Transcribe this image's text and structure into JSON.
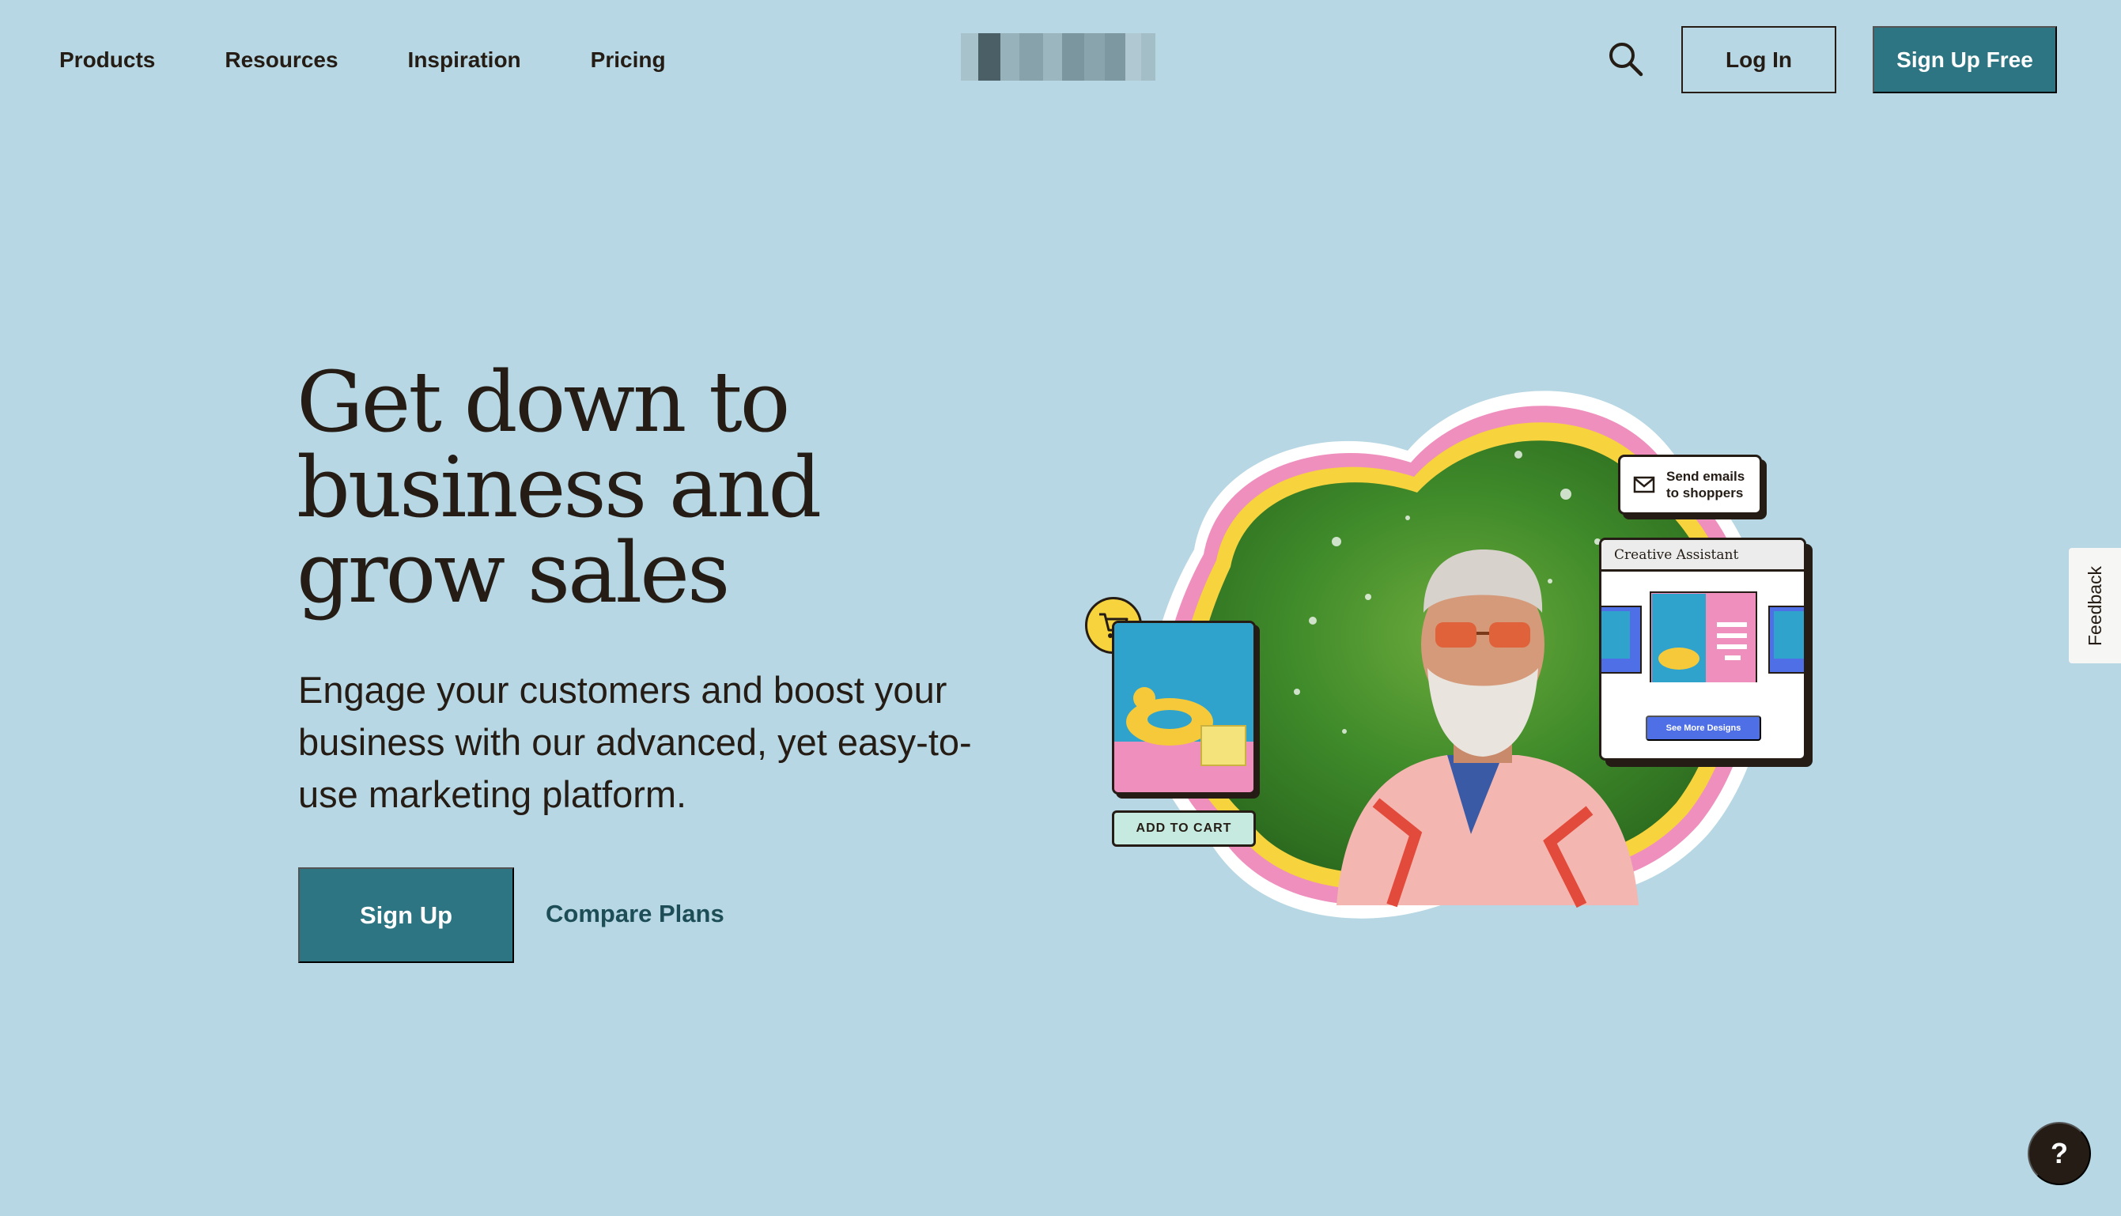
{
  "nav": {
    "links": [
      "Products",
      "Resources",
      "Inspiration",
      "Pricing"
    ],
    "login_label": "Log In",
    "signup_free_label": "Sign Up Free",
    "search_icon": "search-icon"
  },
  "hero": {
    "title": "Get down to business and grow sales",
    "subtitle": "Engage your customers and boost your business with our advanced, yet easy-to-use marketing platform.",
    "signup_label": "Sign Up",
    "compare_label": "Compare Plans"
  },
  "illustration": {
    "add_to_cart": "ADD TO CART",
    "email_line1": "Send emails",
    "email_line2": "to shoppers",
    "assistant_title": "Creative Assistant",
    "see_more": "See More Designs"
  },
  "widgets": {
    "feedback": "Feedback",
    "help": "?"
  },
  "colors": {
    "background": "#b6d7e3",
    "primary": "#2d7582",
    "text": "#241c15",
    "accent_yellow": "#f7d33d",
    "accent_pink": "#ef8fbd"
  }
}
